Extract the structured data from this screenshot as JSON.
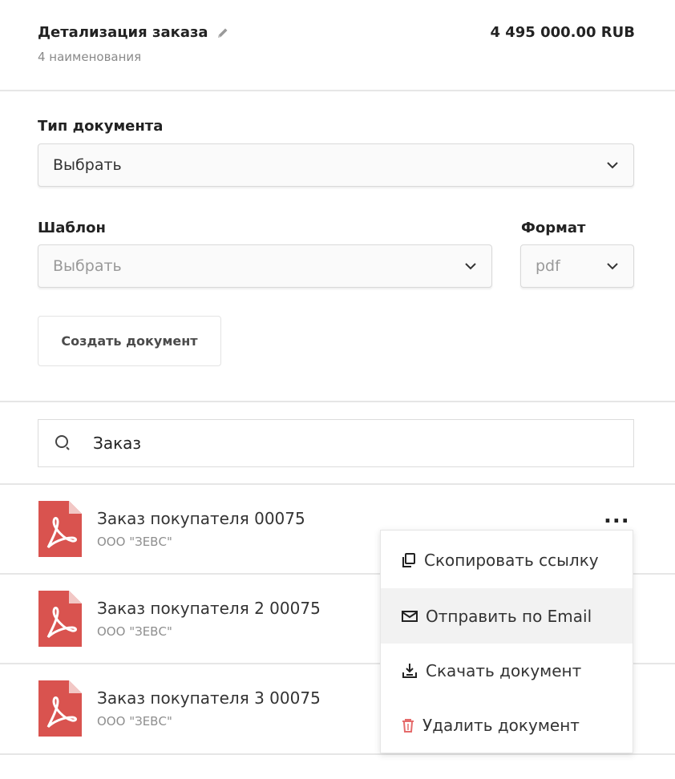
{
  "header": {
    "title": "Детализация заказа",
    "items_count": "4 наименования",
    "total": "4 495 000.00 RUB"
  },
  "form": {
    "doc_type_label": "Тип документа",
    "doc_type_value": "Выбрать",
    "template_label": "Шаблон",
    "template_value": "Выбрать",
    "format_label": "Формат",
    "format_value": "pdf",
    "create_button": "Создать документ"
  },
  "search": {
    "value": "Заказ"
  },
  "documents": [
    {
      "name": "Заказ покупателя 00075",
      "org": "ООО \"ЗЕВС\""
    },
    {
      "name": "Заказ покупателя 2 00075",
      "org": "ООО \"ЗЕВС\""
    },
    {
      "name": "Заказ покупателя 3 00075",
      "org": "ООО \"ЗЕВС\""
    }
  ],
  "more_label": "...",
  "context_menu": {
    "copy_link": "Скопировать ссылку",
    "send_email": "Отправить по Email",
    "download": "Скачать документ",
    "delete": "Удалить документ"
  },
  "colors": {
    "pdf_red": "#d9534f",
    "pdf_red_light": "#f2c7c5",
    "delete_red": "#e56b6b",
    "divider": "#e6e6e6"
  },
  "icons": {
    "edit": "pencil-icon",
    "chevron": "chevron-down-icon",
    "search": "search-icon",
    "pdf": "pdf-file-icon",
    "copy": "copy-icon",
    "mail": "mail-icon",
    "download": "download-icon",
    "delete": "trash-icon"
  }
}
